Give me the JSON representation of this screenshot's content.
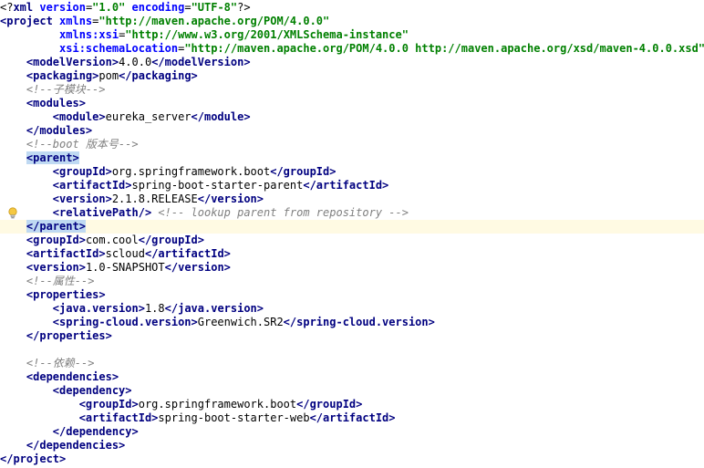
{
  "editor": {
    "lines": [
      [
        {
          "t": "<?",
          "c": "pi"
        },
        {
          "t": "xml ",
          "c": "tag"
        },
        {
          "t": "version",
          "c": "attrname"
        },
        {
          "t": "=",
          "c": "text"
        },
        {
          "t": "\"1.0\"",
          "c": "attrval"
        },
        {
          "t": " ",
          "c": "text"
        },
        {
          "t": "encoding",
          "c": "attrname"
        },
        {
          "t": "=",
          "c": "text"
        },
        {
          "t": "\"UTF-8\"",
          "c": "attrval"
        },
        {
          "t": "?>",
          "c": "pi"
        }
      ],
      [
        {
          "t": "<project ",
          "c": "tag"
        },
        {
          "t": "xmlns",
          "c": "attrname"
        },
        {
          "t": "=",
          "c": "text"
        },
        {
          "t": "\"http://maven.apache.org/POM/4.0.0\"",
          "c": "attrval"
        }
      ],
      [
        {
          "t": "         ",
          "c": "text"
        },
        {
          "t": "xmlns:xsi",
          "c": "attrname"
        },
        {
          "t": "=",
          "c": "text"
        },
        {
          "t": "\"http://www.w3.org/2001/XMLSchema-instance\"",
          "c": "attrval"
        }
      ],
      [
        {
          "t": "         ",
          "c": "text"
        },
        {
          "t": "xsi:schemaLocation",
          "c": "attrname"
        },
        {
          "t": "=",
          "c": "text"
        },
        {
          "t": "\"http://maven.apache.org/POM/4.0.0 http://maven.apache.org/xsd/maven-4.0.0.xsd\"",
          "c": "attrval"
        },
        {
          "t": ">",
          "c": "tag"
        }
      ],
      [
        {
          "t": "    ",
          "c": "text"
        },
        {
          "t": "<modelVersion>",
          "c": "tag"
        },
        {
          "t": "4.0.0",
          "c": "text"
        },
        {
          "t": "</modelVersion>",
          "c": "tag"
        }
      ],
      [
        {
          "t": "    ",
          "c": "text"
        },
        {
          "t": "<packaging>",
          "c": "tag"
        },
        {
          "t": "pom",
          "c": "text"
        },
        {
          "t": "</packaging>",
          "c": "tag"
        }
      ],
      [
        {
          "t": "    ",
          "c": "text"
        },
        {
          "t": "<!--子模块-->",
          "c": "comment"
        }
      ],
      [
        {
          "t": "    ",
          "c": "text"
        },
        {
          "t": "<modules>",
          "c": "tag"
        }
      ],
      [
        {
          "t": "        ",
          "c": "text"
        },
        {
          "t": "<module>",
          "c": "tag"
        },
        {
          "t": "eureka_server",
          "c": "text"
        },
        {
          "t": "</module>",
          "c": "tag"
        }
      ],
      [
        {
          "t": "    ",
          "c": "text"
        },
        {
          "t": "</modules>",
          "c": "tag"
        }
      ],
      [
        {
          "t": "    ",
          "c": "text"
        },
        {
          "t": "<!--boot 版本号-->",
          "c": "comment"
        }
      ],
      [
        {
          "t": "    ",
          "c": "text"
        },
        {
          "t": "<parent>",
          "c": "tag sel"
        }
      ],
      [
        {
          "t": "        ",
          "c": "text"
        },
        {
          "t": "<groupId>",
          "c": "tag"
        },
        {
          "t": "org.springframework.boot",
          "c": "text"
        },
        {
          "t": "</groupId>",
          "c": "tag"
        }
      ],
      [
        {
          "t": "        ",
          "c": "text"
        },
        {
          "t": "<artifactId>",
          "c": "tag"
        },
        {
          "t": "spring-boot-starter-parent",
          "c": "text"
        },
        {
          "t": "</artifactId>",
          "c": "tag"
        }
      ],
      [
        {
          "t": "        ",
          "c": "text"
        },
        {
          "t": "<version>",
          "c": "tag"
        },
        {
          "t": "2.1.8.RELEASE",
          "c": "text"
        },
        {
          "t": "</version>",
          "c": "tag"
        }
      ],
      [
        {
          "t": "        ",
          "c": "text"
        },
        {
          "t": "<relativePath/>",
          "c": "tag"
        },
        {
          "t": " ",
          "c": "text"
        },
        {
          "t": "<!-- lookup parent from repository -->",
          "c": "comment"
        }
      ],
      [
        {
          "t": "    ",
          "c": "text"
        },
        {
          "t": "</parent>",
          "c": "tag sel"
        }
      ],
      [
        {
          "t": "    ",
          "c": "text"
        },
        {
          "t": "<groupId>",
          "c": "tag"
        },
        {
          "t": "com.cool",
          "c": "text"
        },
        {
          "t": "</groupId>",
          "c": "tag"
        }
      ],
      [
        {
          "t": "    ",
          "c": "text"
        },
        {
          "t": "<artifactId>",
          "c": "tag"
        },
        {
          "t": "scloud",
          "c": "text"
        },
        {
          "t": "</artifactId>",
          "c": "tag"
        }
      ],
      [
        {
          "t": "    ",
          "c": "text"
        },
        {
          "t": "<version>",
          "c": "tag"
        },
        {
          "t": "1.0-SNAPSHOT",
          "c": "text"
        },
        {
          "t": "</version>",
          "c": "tag"
        }
      ],
      [
        {
          "t": "    ",
          "c": "text"
        },
        {
          "t": "<!--属性-->",
          "c": "comment"
        }
      ],
      [
        {
          "t": "    ",
          "c": "text"
        },
        {
          "t": "<properties>",
          "c": "tag"
        }
      ],
      [
        {
          "t": "        ",
          "c": "text"
        },
        {
          "t": "<java.version>",
          "c": "tag"
        },
        {
          "t": "1.8",
          "c": "text"
        },
        {
          "t": "</java.version>",
          "c": "tag"
        }
      ],
      [
        {
          "t": "        ",
          "c": "text"
        },
        {
          "t": "<spring-cloud.version>",
          "c": "tag"
        },
        {
          "t": "Greenwich.SR2",
          "c": "text"
        },
        {
          "t": "</spring-cloud.version>",
          "c": "tag"
        }
      ],
      [
        {
          "t": "    ",
          "c": "text"
        },
        {
          "t": "</properties>",
          "c": "tag"
        }
      ],
      [],
      [
        {
          "t": "    ",
          "c": "text"
        },
        {
          "t": "<!--依赖-->",
          "c": "comment"
        }
      ],
      [
        {
          "t": "    ",
          "c": "text"
        },
        {
          "t": "<dependencies>",
          "c": "tag"
        }
      ],
      [
        {
          "t": "        ",
          "c": "text"
        },
        {
          "t": "<dependency>",
          "c": "tag"
        }
      ],
      [
        {
          "t": "            ",
          "c": "text"
        },
        {
          "t": "<groupId>",
          "c": "tag"
        },
        {
          "t": "org.springframework.boot",
          "c": "text"
        },
        {
          "t": "</groupId>",
          "c": "tag"
        }
      ],
      [
        {
          "t": "            ",
          "c": "text"
        },
        {
          "t": "<artifactId>",
          "c": "tag"
        },
        {
          "t": "spring-boot-starter-web",
          "c": "text"
        },
        {
          "t": "</artifactId>",
          "c": "tag"
        }
      ],
      [
        {
          "t": "        ",
          "c": "text"
        },
        {
          "t": "</dependency>",
          "c": "tag"
        }
      ],
      [
        {
          "t": "    ",
          "c": "text"
        },
        {
          "t": "</dependencies>",
          "c": "tag"
        }
      ],
      [
        {
          "t": "</project>",
          "c": "tag"
        }
      ]
    ],
    "current_line": 16,
    "bulb_line": 15,
    "colors": {
      "tag": "#000080",
      "attr_name": "#0000ff",
      "attr_value": "#008000",
      "comment": "#808080",
      "matched_tag_highlight": "#bfd9f2",
      "current_line_highlight": "#fffae3"
    },
    "gutter_icon": "lightbulb-icon"
  }
}
